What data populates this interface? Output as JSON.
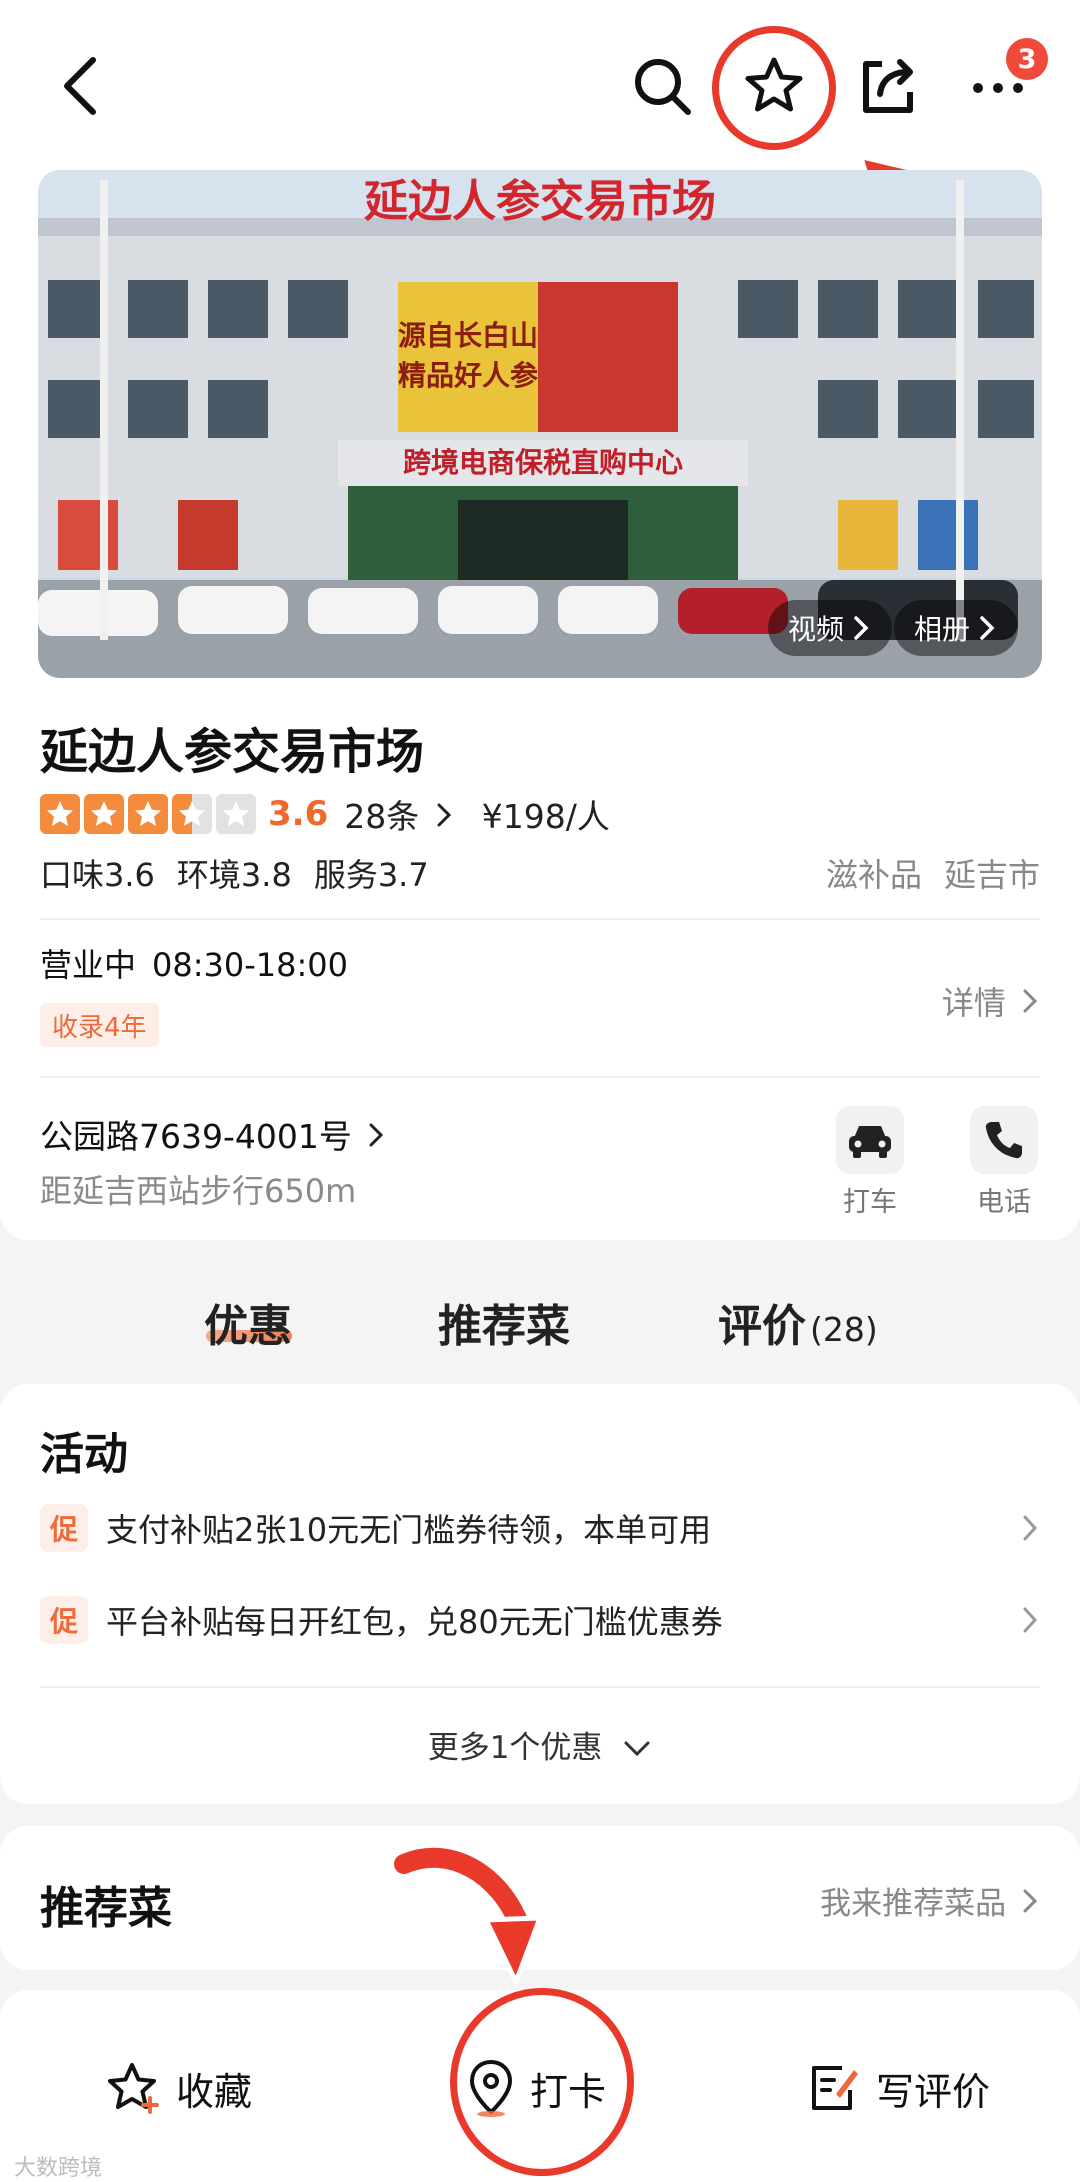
{
  "nav": {
    "notification_count": "3",
    "icons": [
      "back-icon",
      "search-icon",
      "star-icon",
      "share-icon",
      "more-icon"
    ]
  },
  "hero": {
    "sign_text": "延边人参交易市场",
    "screen_line1": "源自长白山",
    "screen_line2": "精品好人参",
    "banner_text": "跨境电商保税直购中心",
    "video_label": "视频",
    "album_label": "相册"
  },
  "shop": {
    "name": "延边人参交易市场",
    "rating": {
      "stars": 3.5,
      "score": "3.6",
      "reviews": "28条",
      "price": "¥198/人"
    },
    "sub_scores": [
      "口味3.6",
      "环境3.8",
      "服务3.7"
    ],
    "category": "滋补品",
    "city": "延吉市",
    "status": "营业中",
    "hours": "08:30-18:00",
    "since": "收录4年",
    "details_label": "详情",
    "address": "公园路7639-4001号",
    "distance": "距延吉西站步行650m",
    "actions": [
      {
        "label": "打车",
        "icon": "car-icon"
      },
      {
        "label": "电话",
        "icon": "phone-icon"
      }
    ]
  },
  "tabs": {
    "discount": "优惠",
    "recommended": "推荐菜",
    "reviews": "评价",
    "reviews_count": "(28)"
  },
  "activity": {
    "title": "活动",
    "tag": "促",
    "items": [
      "支付补贴2张10元无门槛券待领，本单可用",
      "平台补贴每日开红包，兑80元无门槛优惠券"
    ],
    "more": "更多1个优惠"
  },
  "recommend": {
    "title": "推荐菜",
    "link": "我来推荐菜品"
  },
  "bottom_bar": {
    "favorite": "收藏",
    "checkin": "打卡",
    "review": "写评价"
  },
  "watermark": "大数跨境",
  "colors": {
    "accent": "#ef6a3b",
    "annotation": "#e8392b"
  }
}
